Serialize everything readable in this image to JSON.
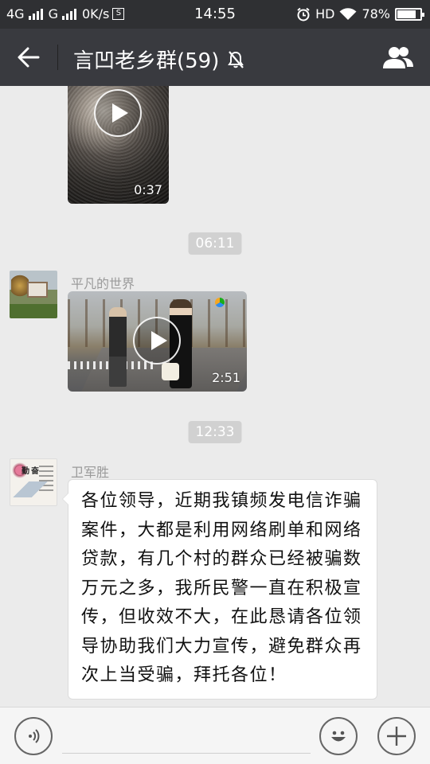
{
  "status_bar": {
    "network1": "4G",
    "network2": "G",
    "speed": "0K/s",
    "speed_icon": "S",
    "time": "14:55",
    "hd": "HD",
    "battery": "78%",
    "battery_level": 0.78
  },
  "header": {
    "title": "言凹老乡群(59)",
    "icons": {
      "back": "arrow-left",
      "mute": "bell-off",
      "members": "group-people"
    }
  },
  "messages": [
    {
      "type": "video",
      "duration": "0:37"
    },
    {
      "type": "timestamp",
      "text": "06:11"
    },
    {
      "type": "video",
      "sender": "平凡的世界",
      "duration": "2:51"
    },
    {
      "type": "timestamp",
      "text": "12:33"
    },
    {
      "type": "text",
      "sender": "卫军胜",
      "avatar_seal": "勤奋",
      "text": "各位领导，近期我镇频发电信诈骗案件，大都是利用网络刷单和网络贷款，有几个村的群众已经被骗数万元之多，我所民警一直在积极宣传，但收效不大，在此恳请各位领导协助我们大力宣传，避免群众再次上当受骗，拜托各位！"
    }
  ],
  "input_bar": {
    "placeholder": "",
    "icons": {
      "voice": "voice-wave",
      "emoji": "smiley-face",
      "more": "plus"
    }
  },
  "colors": {
    "status_bg": "#2f3033",
    "title_bg": "#393a3f",
    "chat_bg": "#ebebeb",
    "timestamp_bg": "#d1d1d1",
    "bubble_bg": "#ffffff"
  }
}
